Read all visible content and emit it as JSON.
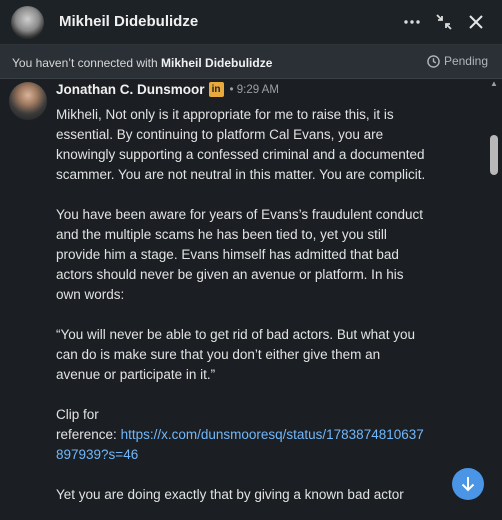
{
  "header": {
    "name": "Mikheil Didebulidze",
    "more_icon": "more-horizontal-icon",
    "collapse_icon": "collapse-arrows-icon",
    "close_icon": "close-icon"
  },
  "notice": {
    "prefix": "You haven’t connected with",
    "name": "Mikheil Didebulidze",
    "status": "Pending"
  },
  "message": {
    "sender": "Jonathan C. Dunsmoor",
    "badge": "in",
    "time": "• 9:29 AM",
    "paragraphs": [
      "Mikheli, Not only is it appropriate for me to raise this, it is essential. By continuing to platform Cal Evans, you are knowingly supporting a confessed criminal and a documented scammer. You are not neutral in this matter. You are complicit.",
      "You have been aware for years of Evans’s fraudulent conduct and the multiple scams he has been tied to, yet you still provide him a stage. Evans himself has admitted that bad actors should never be given an avenue or platform. In his own words:",
      "“You will never be able to get rid of bad actors. But what you can do is make sure that you don’t either give them an avenue or participate in it.”"
    ],
    "clip_label": "Clip for",
    "ref_label": "reference:",
    "link": "https://x.com/dunsmooresq/status/1783874810637897939?s=46",
    "next_line": "Yet you are doing exactly that by giving a known bad actor"
  },
  "colors": {
    "background": "#1b1f23",
    "link": "#71b7fb",
    "accent_button": "#4b95e6",
    "linkedin_badge": "#e8a93d"
  }
}
